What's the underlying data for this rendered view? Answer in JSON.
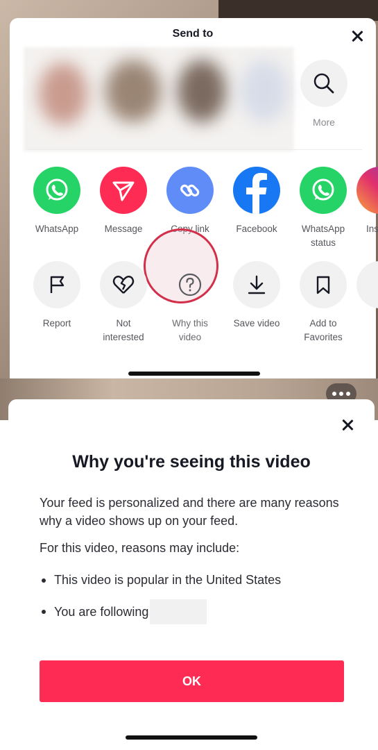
{
  "share_sheet": {
    "title": "Send to",
    "more_label": "More",
    "apps": [
      {
        "label": "WhatsApp",
        "icon": "whatsapp-icon",
        "color": "#25d366"
      },
      {
        "label": "Message",
        "icon": "send-icon",
        "color": "#fe2c55"
      },
      {
        "label": "Copy link",
        "icon": "link-icon",
        "color": "#5f8cf7"
      },
      {
        "label": "Facebook",
        "icon": "facebook-icon",
        "color": "#1877f2"
      },
      {
        "label": "WhatsApp",
        "label2": "status",
        "icon": "whatsapp-icon",
        "color": "#25d366"
      },
      {
        "label": "Ins",
        "icon": "instagram-icon"
      }
    ],
    "actions": [
      {
        "label": "Report",
        "icon": "flag-icon"
      },
      {
        "label": "Not",
        "label2": "interested",
        "icon": "broken-heart-icon"
      },
      {
        "label": "Why this",
        "label2": "video",
        "icon": "question-icon"
      },
      {
        "label": "Save video",
        "icon": "download-icon"
      },
      {
        "label": "Add to",
        "label2": "Favorites",
        "icon": "bookmark-icon"
      }
    ]
  },
  "why_sheet": {
    "title": "Why you're seeing this video",
    "paragraph1": "Your feed is personalized and there are many reasons why a video shows up on your feed.",
    "paragraph2": "For this video, reasons may include:",
    "reasons": [
      "This video is popular in the United States",
      "You are following"
    ],
    "ok_label": "OK"
  },
  "colors": {
    "accent": "#fe2c55",
    "highlight_ring": "#d2304a"
  }
}
